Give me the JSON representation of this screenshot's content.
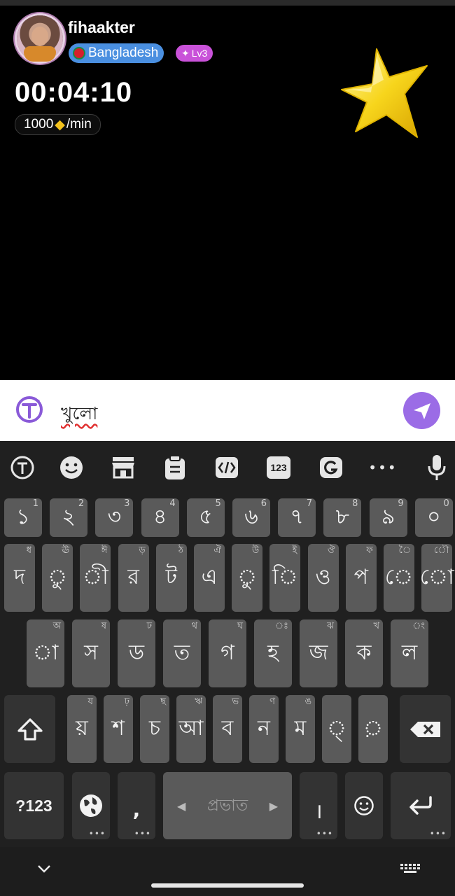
{
  "caller": {
    "username": "fihaakter",
    "country": "Bangladesh",
    "level": "Lv3",
    "timer": "00:04:10",
    "rate_amount": "1000",
    "rate_unit": "/min"
  },
  "input": {
    "text": "খুলো"
  },
  "toolbar": {
    "icons": [
      "translate-icon",
      "emoji-icon",
      "store-icon",
      "clipboard-icon",
      "text-edit-icon",
      "numpad-icon",
      "g-translate-icon",
      "more-icon",
      "mic-icon"
    ],
    "numpad_label": "123",
    "more_label": "•••"
  },
  "keyboard": {
    "row1": [
      {
        "main": "১",
        "hint": "1"
      },
      {
        "main": "২",
        "hint": "2"
      },
      {
        "main": "৩",
        "hint": "3"
      },
      {
        "main": "৪",
        "hint": "4"
      },
      {
        "main": "৫",
        "hint": "5"
      },
      {
        "main": "৬",
        "hint": "6"
      },
      {
        "main": "৭",
        "hint": "7"
      },
      {
        "main": "৮",
        "hint": "8"
      },
      {
        "main": "৯",
        "hint": "9"
      },
      {
        "main": "০",
        "hint": "0"
      }
    ],
    "row2": [
      {
        "main": "দ",
        "hint": "ধ"
      },
      {
        "main": "ু",
        "hint": "ঊ"
      },
      {
        "main": "ী",
        "hint": "ঈ"
      },
      {
        "main": "র",
        "hint": "ড়"
      },
      {
        "main": "ট",
        "hint": "ঠ"
      },
      {
        "main": "এ",
        "hint": "ঐ"
      },
      {
        "main": "ু",
        "hint": "উ"
      },
      {
        "main": "ি",
        "hint": "ই"
      },
      {
        "main": "ও",
        "hint": "ঔ"
      },
      {
        "main": "প",
        "hint": "ফ"
      },
      {
        "main": "ে",
        "hint": "ৈ"
      },
      {
        "main": "ো",
        "hint": "ৌ"
      }
    ],
    "row3": [
      {
        "main": "া",
        "hint": "অ"
      },
      {
        "main": "স",
        "hint": "ষ"
      },
      {
        "main": "ড",
        "hint": "ঢ"
      },
      {
        "main": "ত",
        "hint": "থ"
      },
      {
        "main": "গ",
        "hint": "ঘ"
      },
      {
        "main": "হ",
        "hint": "ঃ"
      },
      {
        "main": "জ",
        "hint": "ঝ"
      },
      {
        "main": "ক",
        "hint": "খ"
      },
      {
        "main": "ল",
        "hint": "ং"
      }
    ],
    "row4": [
      {
        "main": "য়",
        "hint": "য"
      },
      {
        "main": "শ",
        "hint": "ঢ়"
      },
      {
        "main": "চ",
        "hint": "ছ"
      },
      {
        "main": "আ",
        "hint": "ঋ"
      },
      {
        "main": "ব",
        "hint": "ভ"
      },
      {
        "main": "ন",
        "hint": "ণ"
      },
      {
        "main": "ম",
        "hint": "ঙ"
      },
      {
        "main": "্",
        "hint": ""
      },
      {
        "main": "়",
        "hint": ""
      }
    ],
    "symbols_label": "?123",
    "comma_label": ",",
    "space_label": "প্রভাত",
    "period_label": "।"
  },
  "colors": {
    "country_badge": "#4a8fe0",
    "level_badge": "#c952d9",
    "send_button": "#9b6ce6",
    "key": "#5a5a5a",
    "key_dark": "#333333"
  }
}
